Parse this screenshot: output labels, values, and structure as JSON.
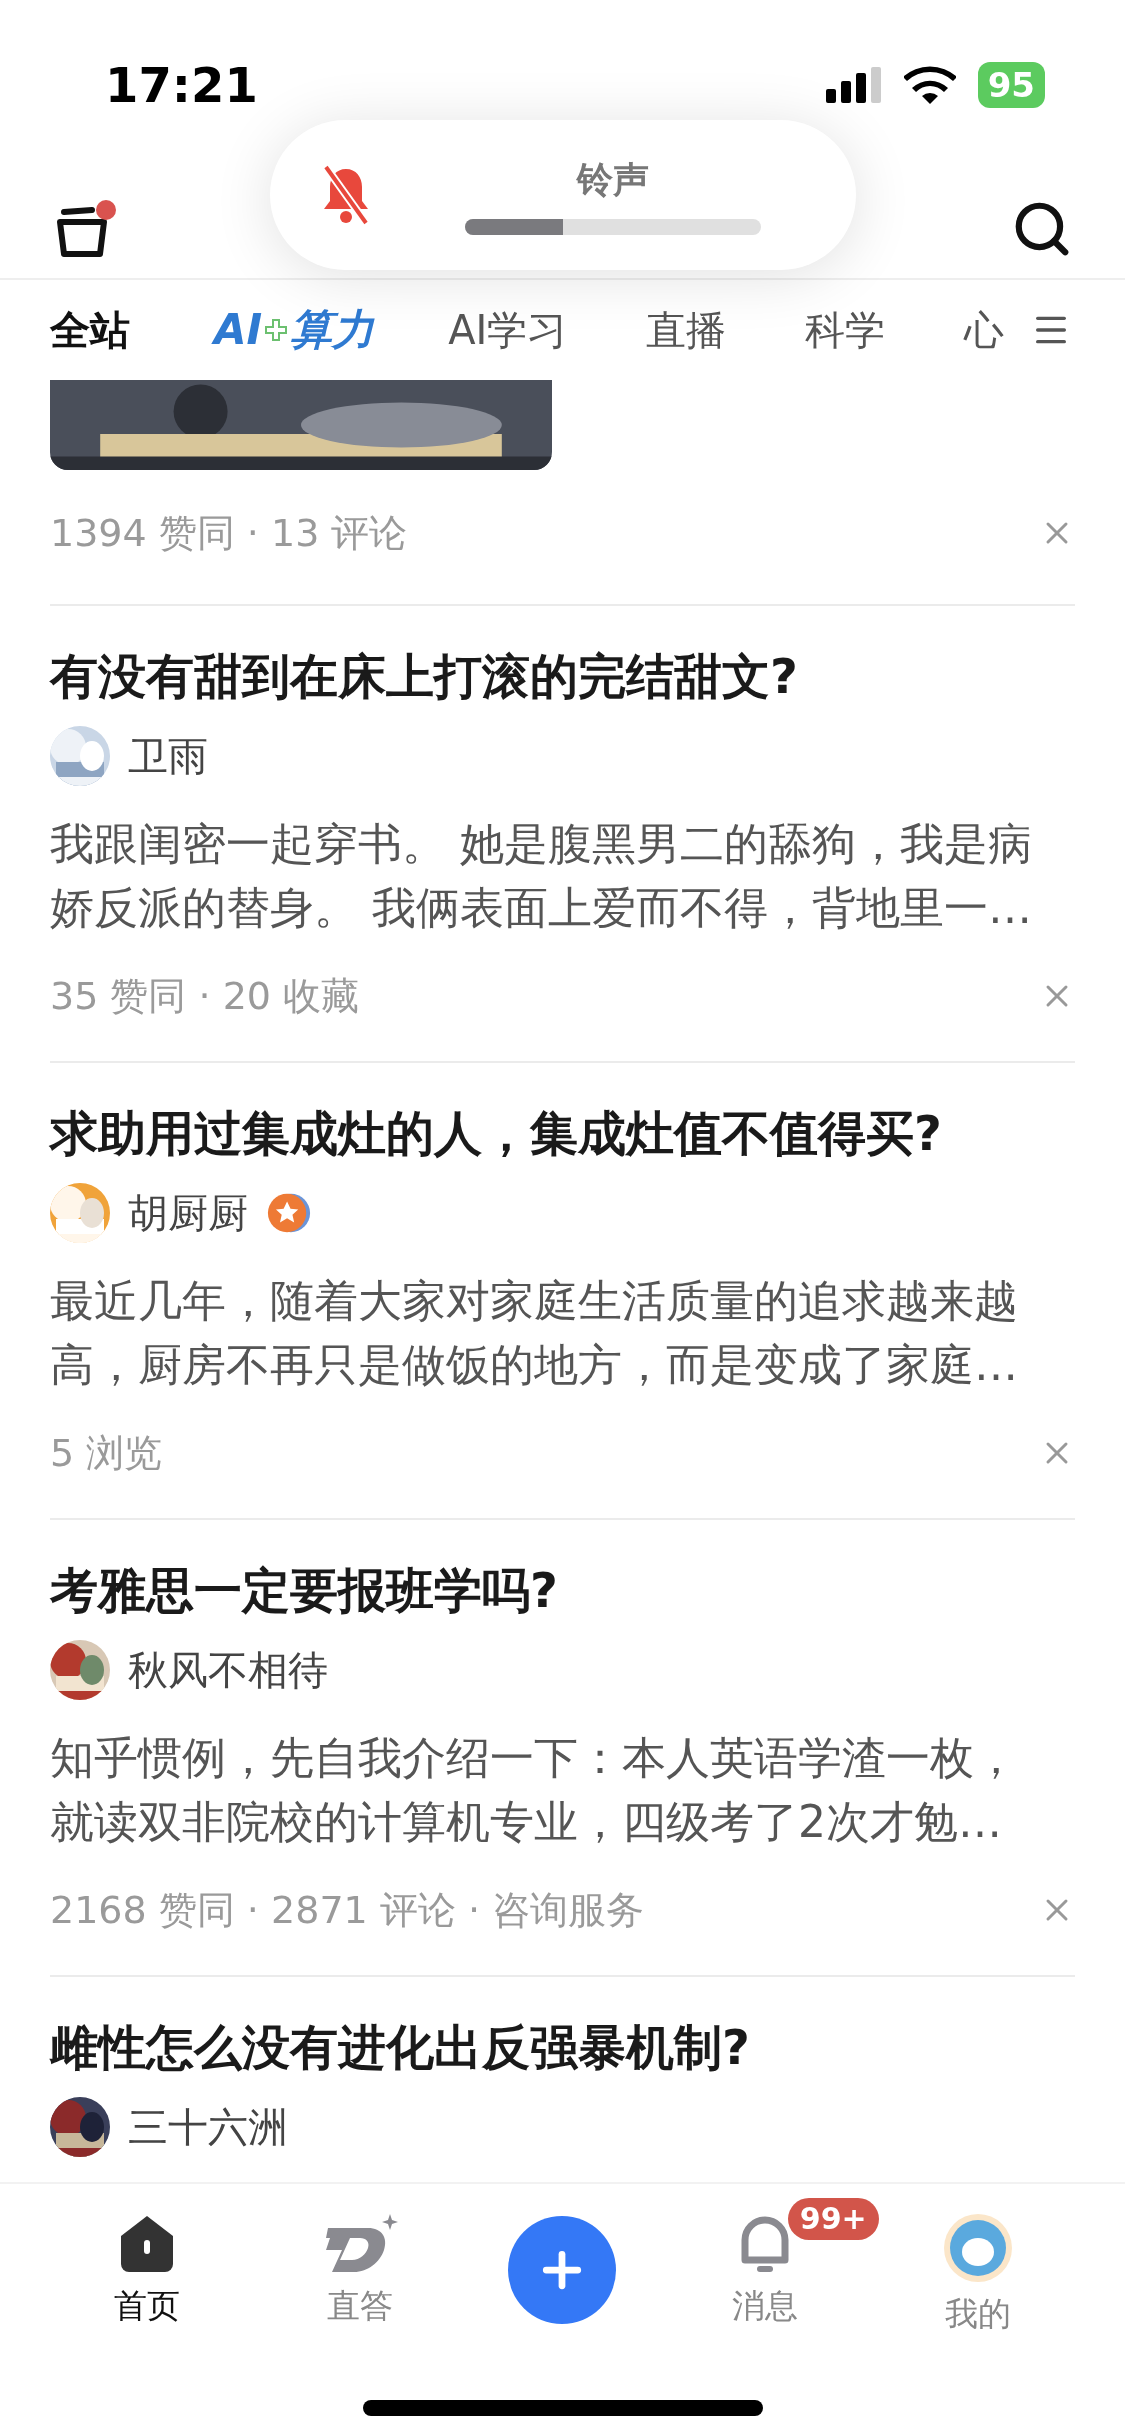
{
  "status_bar": {
    "time": "17:21",
    "battery": "95"
  },
  "volume_hud": {
    "label": "铃声",
    "level": 0.33
  },
  "header": {
    "notification_dot": true
  },
  "tabs": [
    {
      "label": "全站",
      "kind": "text",
      "selected": true
    },
    {
      "label": "AI",
      "label_2": "算力",
      "kind": "logo",
      "selected": false
    },
    {
      "label": "AI学习",
      "kind": "text",
      "selected": false
    },
    {
      "label": "直播",
      "kind": "text",
      "selected": false
    },
    {
      "label": "科学",
      "kind": "text",
      "selected": false
    },
    {
      "label": "心",
      "kind": "text",
      "selected": false
    }
  ],
  "top_card": {
    "kind": "picture",
    "stats": "1394 赞同 · 13 评论"
  },
  "articles": [
    {
      "title": "有没有甜到在床上打滚的完结甜文?",
      "author": "卫雨",
      "verified": false,
      "excerpt": "我跟闺密一起穿书。 她是腹黑男二的舔狗，我是病娇反派的替身。 我俩表面上爱而不得，背地里一…",
      "stats": "35 赞同 · 20 收藏"
    },
    {
      "title": "求助用过集成灶的人，集成灶值不值得买?",
      "author": "胡厨厨",
      "verified": true,
      "excerpt": "最近几年，随着大家对家庭生活质量的追求越来越高，厨房不再只是做饭的地方，而是变成了家庭…",
      "stats": "5 浏览"
    },
    {
      "title": "考雅思一定要报班学吗?",
      "author": "秋风不相待",
      "verified": false,
      "excerpt": "知乎惯例，先自我介绍一下：本人英语学渣一枚，就读双非院校的计算机专业，四级考了2次才勉…",
      "stats": "2168 赞同 · 2871 评论 · 咨询服务"
    },
    {
      "title": "雌性怎么没有进化出反强暴机制?",
      "author": "三十六洲",
      "verified": false
    }
  ],
  "bottom_nav": [
    {
      "label": "首页",
      "kind": "home",
      "selected": true
    },
    {
      "label": "直答",
      "kind": "answer",
      "selected": false
    },
    {
      "kind": "post"
    },
    {
      "label": "消息",
      "kind": "messages",
      "badge": "99+",
      "selected": false
    },
    {
      "label": "我的",
      "kind": "profile",
      "selected": false
    }
  ]
}
